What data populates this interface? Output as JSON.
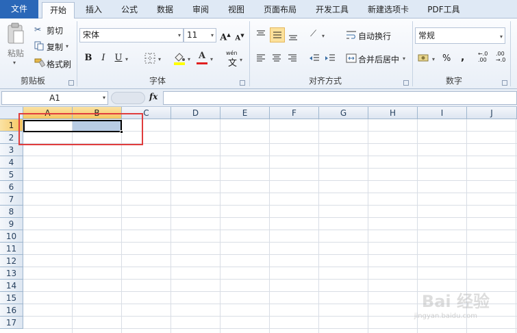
{
  "tabs": [
    "文件",
    "开始",
    "插入",
    "公式",
    "数据",
    "审阅",
    "视图",
    "页面布局",
    "开发工具",
    "新建选项卡",
    "PDF工具"
  ],
  "clipboard": {
    "paste": "粘贴",
    "cut": "剪切",
    "copy": "复制",
    "format_painter": "格式刷",
    "label": "剪贴板"
  },
  "font": {
    "family": "宋体",
    "size": "11",
    "bold": "B",
    "italic": "I",
    "underline": "U",
    "grow": "A",
    "shrink": "A",
    "font_color_glyph": "A",
    "phonetic": "wén",
    "label": "字体"
  },
  "alignment": {
    "wrap_text": "自动换行",
    "merge_center": "合并后居中",
    "label": "对齐方式"
  },
  "number": {
    "format": "常规",
    "percent": "%",
    "comma": ",",
    "increase_decimal": "←.0\n.00",
    "decrease_decimal": ".00\n→.0",
    "label": "数字"
  },
  "formula_bar": {
    "name_box": "A1",
    "fx": "fx",
    "value": ""
  },
  "columns": [
    "A",
    "B",
    "C",
    "D",
    "E",
    "F",
    "G",
    "H",
    "I",
    "J"
  ],
  "rows": [
    "1",
    "2",
    "3",
    "4",
    "5",
    "6",
    "7",
    "8",
    "9",
    "10",
    "11",
    "12",
    "13",
    "14",
    "15",
    "16",
    "17"
  ],
  "watermark": {
    "text": "Bai 经验",
    "sub": "jingyan.baidu.com"
  },
  "colors": {
    "file_tab": "#2a67b8",
    "selection_fill": "#b8cce4",
    "annotation": "#e03c3c",
    "header_selected": "#f5c560"
  }
}
